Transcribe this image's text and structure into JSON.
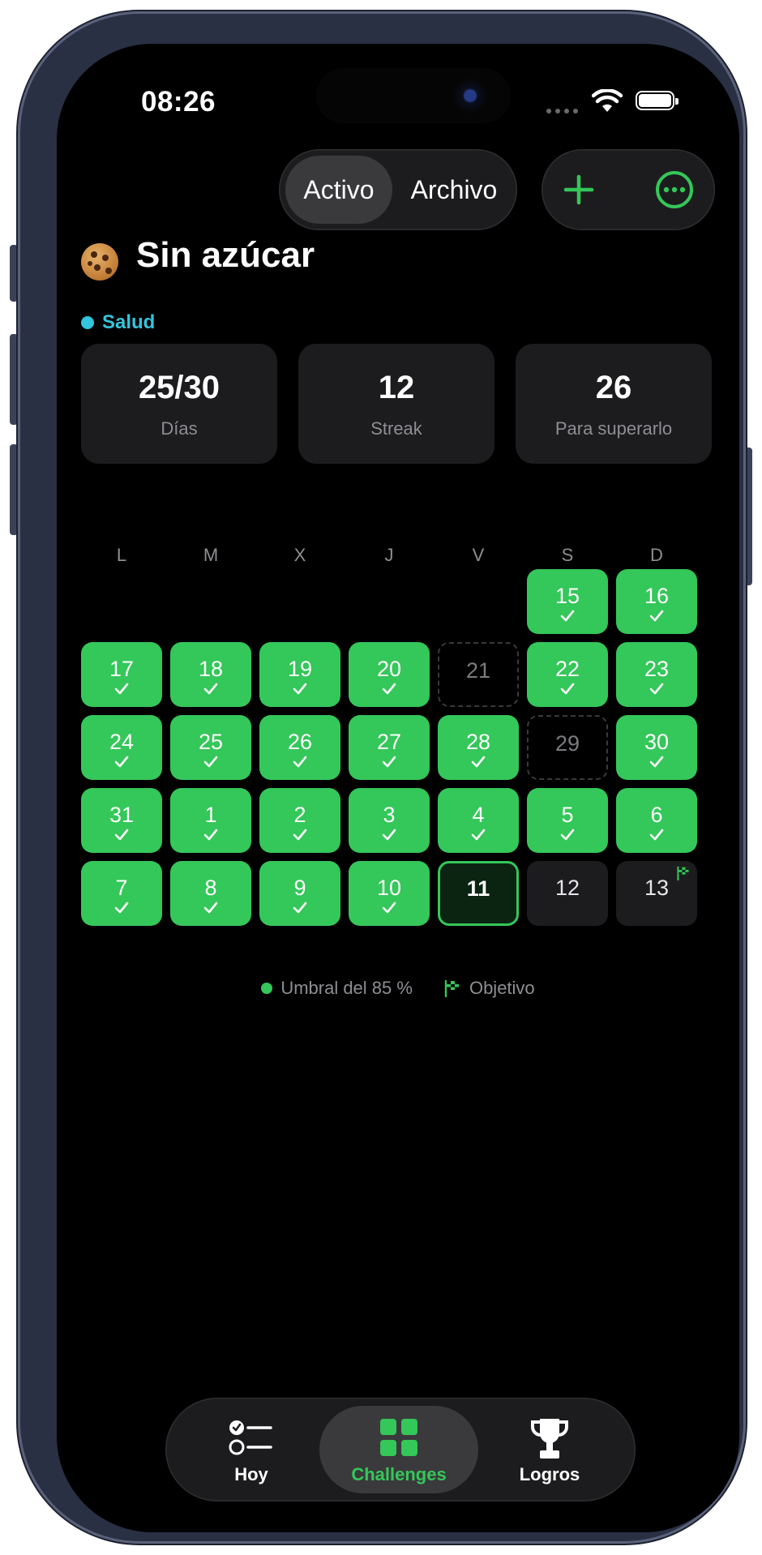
{
  "status_bar": {
    "time": "08:26"
  },
  "segmented": {
    "active": "Activo",
    "archive": "Archivo"
  },
  "actions": {
    "add_icon": "plus-icon",
    "more_icon": "ellipsis-circle-icon"
  },
  "challenge": {
    "emoji": "cookie-icon",
    "title": "Sin azúcar",
    "category": "Salud",
    "category_color": "#32c5dd"
  },
  "stats": [
    {
      "value": "25/30",
      "label": "Días"
    },
    {
      "value": "12",
      "label": "Streak"
    },
    {
      "value": "26",
      "label": "Para superarlo"
    }
  ],
  "calendar": {
    "weekdays": [
      "L",
      "M",
      "X",
      "J",
      "V",
      "S",
      "D"
    ],
    "done_color": "#34c759",
    "weeks": [
      [
        null,
        null,
        null,
        null,
        null,
        {
          "day": "15",
          "state": "done"
        },
        {
          "day": "16",
          "state": "done"
        }
      ],
      [
        {
          "day": "17",
          "state": "done"
        },
        {
          "day": "18",
          "state": "done"
        },
        {
          "day": "19",
          "state": "done"
        },
        {
          "day": "20",
          "state": "done"
        },
        {
          "day": "21",
          "state": "missed"
        },
        {
          "day": "22",
          "state": "done"
        },
        {
          "day": "23",
          "state": "done"
        }
      ],
      [
        {
          "day": "24",
          "state": "done"
        },
        {
          "day": "25",
          "state": "done"
        },
        {
          "day": "26",
          "state": "done"
        },
        {
          "day": "27",
          "state": "done"
        },
        {
          "day": "28",
          "state": "done"
        },
        {
          "day": "29",
          "state": "missed"
        },
        {
          "day": "30",
          "state": "done"
        }
      ],
      [
        {
          "day": "31",
          "state": "done"
        },
        {
          "day": "1",
          "state": "done"
        },
        {
          "day": "2",
          "state": "done"
        },
        {
          "day": "3",
          "state": "done"
        },
        {
          "day": "4",
          "state": "done"
        },
        {
          "day": "5",
          "state": "done"
        },
        {
          "day": "6",
          "state": "done"
        }
      ],
      [
        {
          "day": "7",
          "state": "done"
        },
        {
          "day": "8",
          "state": "done"
        },
        {
          "day": "9",
          "state": "done"
        },
        {
          "day": "10",
          "state": "done"
        },
        {
          "day": "11",
          "state": "today"
        },
        {
          "day": "12",
          "state": "future"
        },
        {
          "day": "13",
          "state": "goal"
        }
      ]
    ]
  },
  "legend": {
    "threshold": "Umbral del 85 %",
    "goal": "Objetivo"
  },
  "tabbar": {
    "items": [
      {
        "label": "Hoy",
        "icon": "checklist-icon"
      },
      {
        "label": "Challenges",
        "icon": "grid-icon",
        "selected": true
      },
      {
        "label": "Logros",
        "icon": "trophy-icon"
      }
    ]
  }
}
